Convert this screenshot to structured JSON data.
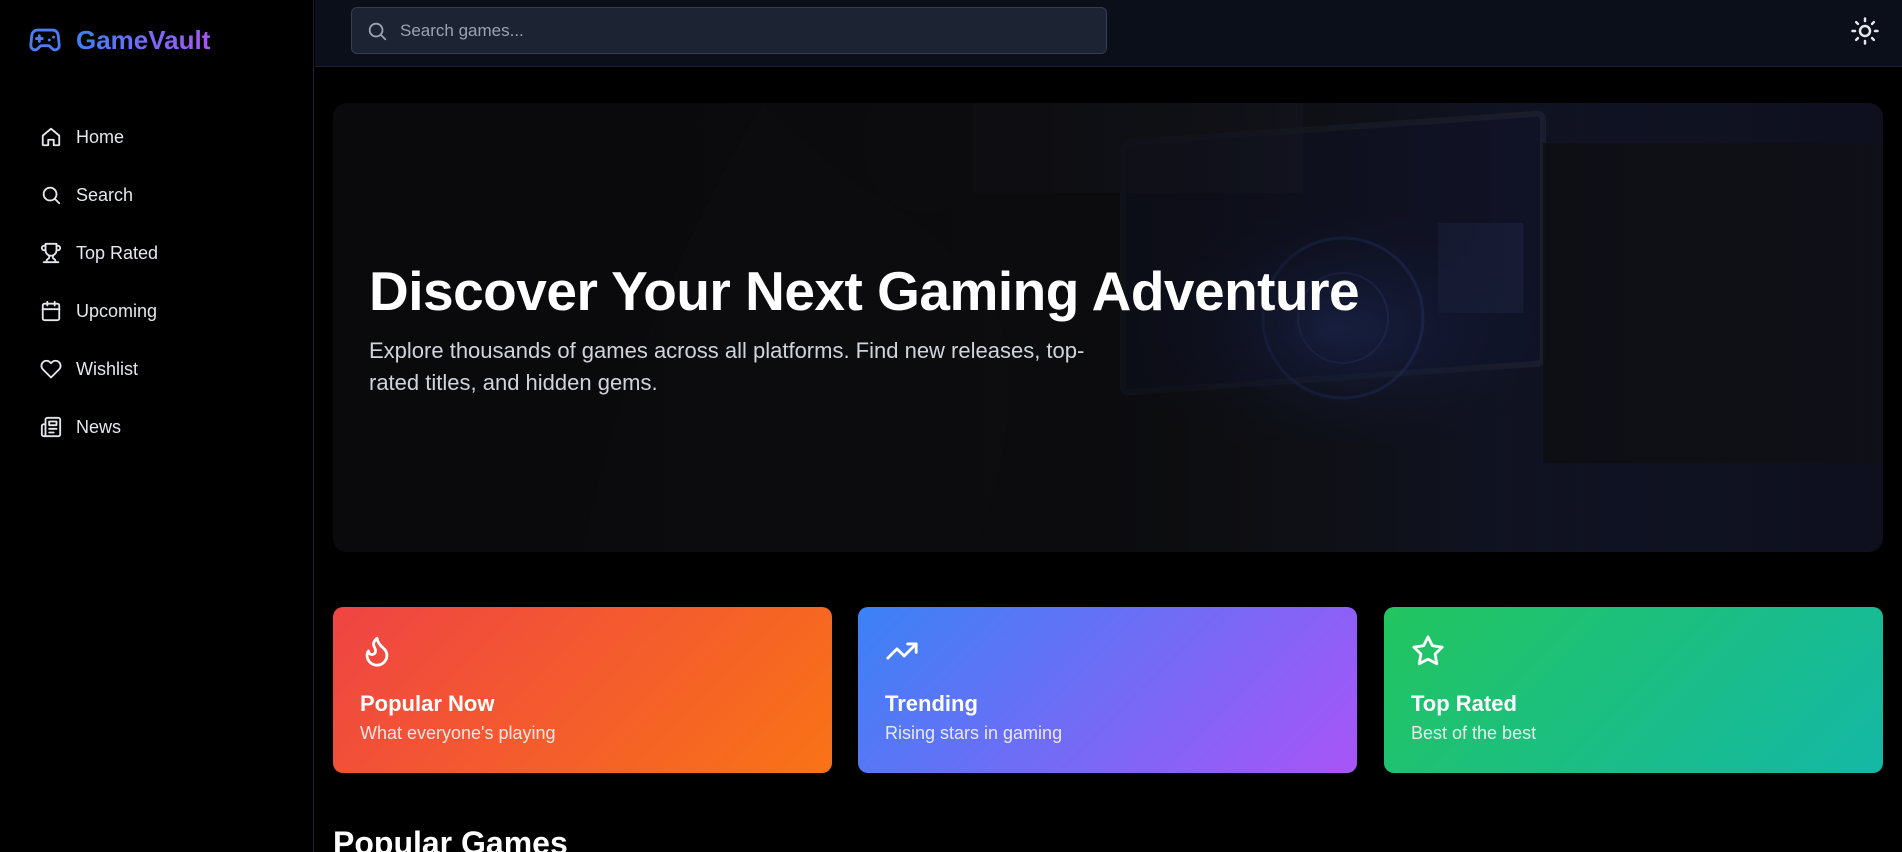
{
  "app": {
    "name": "GameVault",
    "brand_gradient": [
      "#3b82f6",
      "#a855f7"
    ]
  },
  "sidebar": {
    "items": [
      {
        "label": "Home",
        "icon": "home-icon"
      },
      {
        "label": "Search",
        "icon": "search-icon"
      },
      {
        "label": "Top Rated",
        "icon": "trophy-icon"
      },
      {
        "label": "Upcoming",
        "icon": "calendar-icon"
      },
      {
        "label": "Wishlist",
        "icon": "heart-icon"
      },
      {
        "label": "News",
        "icon": "newspaper-icon"
      }
    ]
  },
  "topbar": {
    "search_placeholder": "Search games...",
    "search_value": "",
    "theme_icon": "sun-icon"
  },
  "hero": {
    "title": "Discover Your Next Gaming Adventure",
    "subtitle": "Explore thousands of games across all platforms. Find new releases, top-rated titles, and hidden gems."
  },
  "categories": [
    {
      "title": "Popular Now",
      "subtitle": "What everyone's playing",
      "icon": "flame-icon",
      "colors": [
        "#ef4444",
        "#f97316"
      ]
    },
    {
      "title": "Trending",
      "subtitle": "Rising stars in gaming",
      "icon": "trending-up-icon",
      "colors": [
        "#3b82f6",
        "#a855f7"
      ]
    },
    {
      "title": "Top Rated",
      "subtitle": "Best of the best",
      "icon": "star-icon",
      "colors": [
        "#22c55e",
        "#14b8a6"
      ]
    }
  ],
  "sections": {
    "popular_games_heading": "Popular Games"
  }
}
